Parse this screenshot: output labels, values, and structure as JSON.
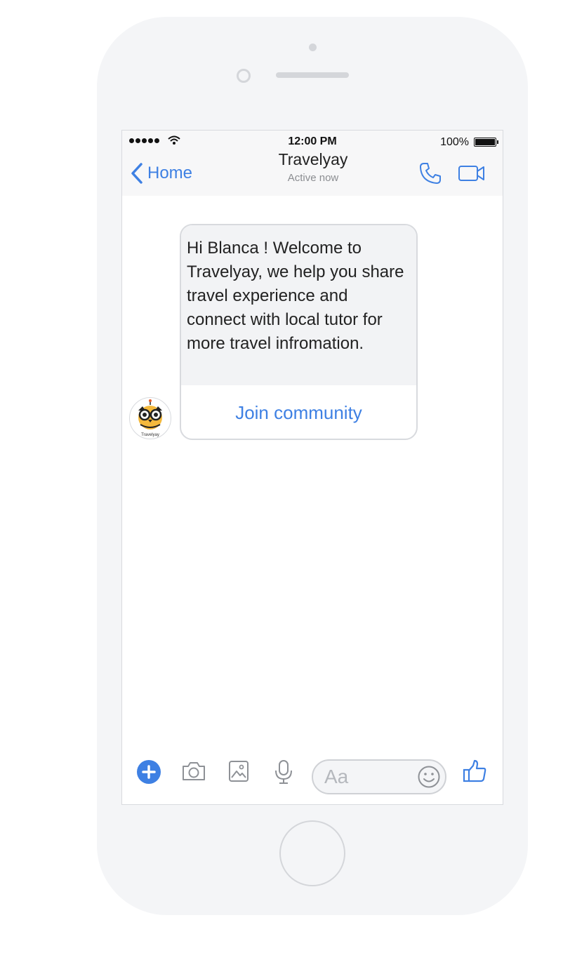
{
  "status_bar": {
    "time": "12:00 PM",
    "battery": "100%"
  },
  "nav": {
    "back_label": "Home",
    "title": "Travelyay",
    "subtitle": "Active now"
  },
  "message": {
    "text": "Hi Blanca ! Welcome to Travelyay, we help you share travel experience and connect with local tutor for more travel infromation.",
    "action_label": "Join community",
    "avatar_caption": "Travelyay"
  },
  "composer": {
    "placeholder": "Aa"
  },
  "colors": {
    "accent": "#3e80e3",
    "phone_body": "#f4f5f7",
    "bubble_bg": "#f2f3f5"
  },
  "icons": [
    "back-chevron-icon",
    "phone-call-icon",
    "video-camera-icon",
    "plus-icon",
    "camera-icon",
    "image-icon",
    "microphone-icon",
    "emoji-icon",
    "thumbs-up-icon"
  ]
}
